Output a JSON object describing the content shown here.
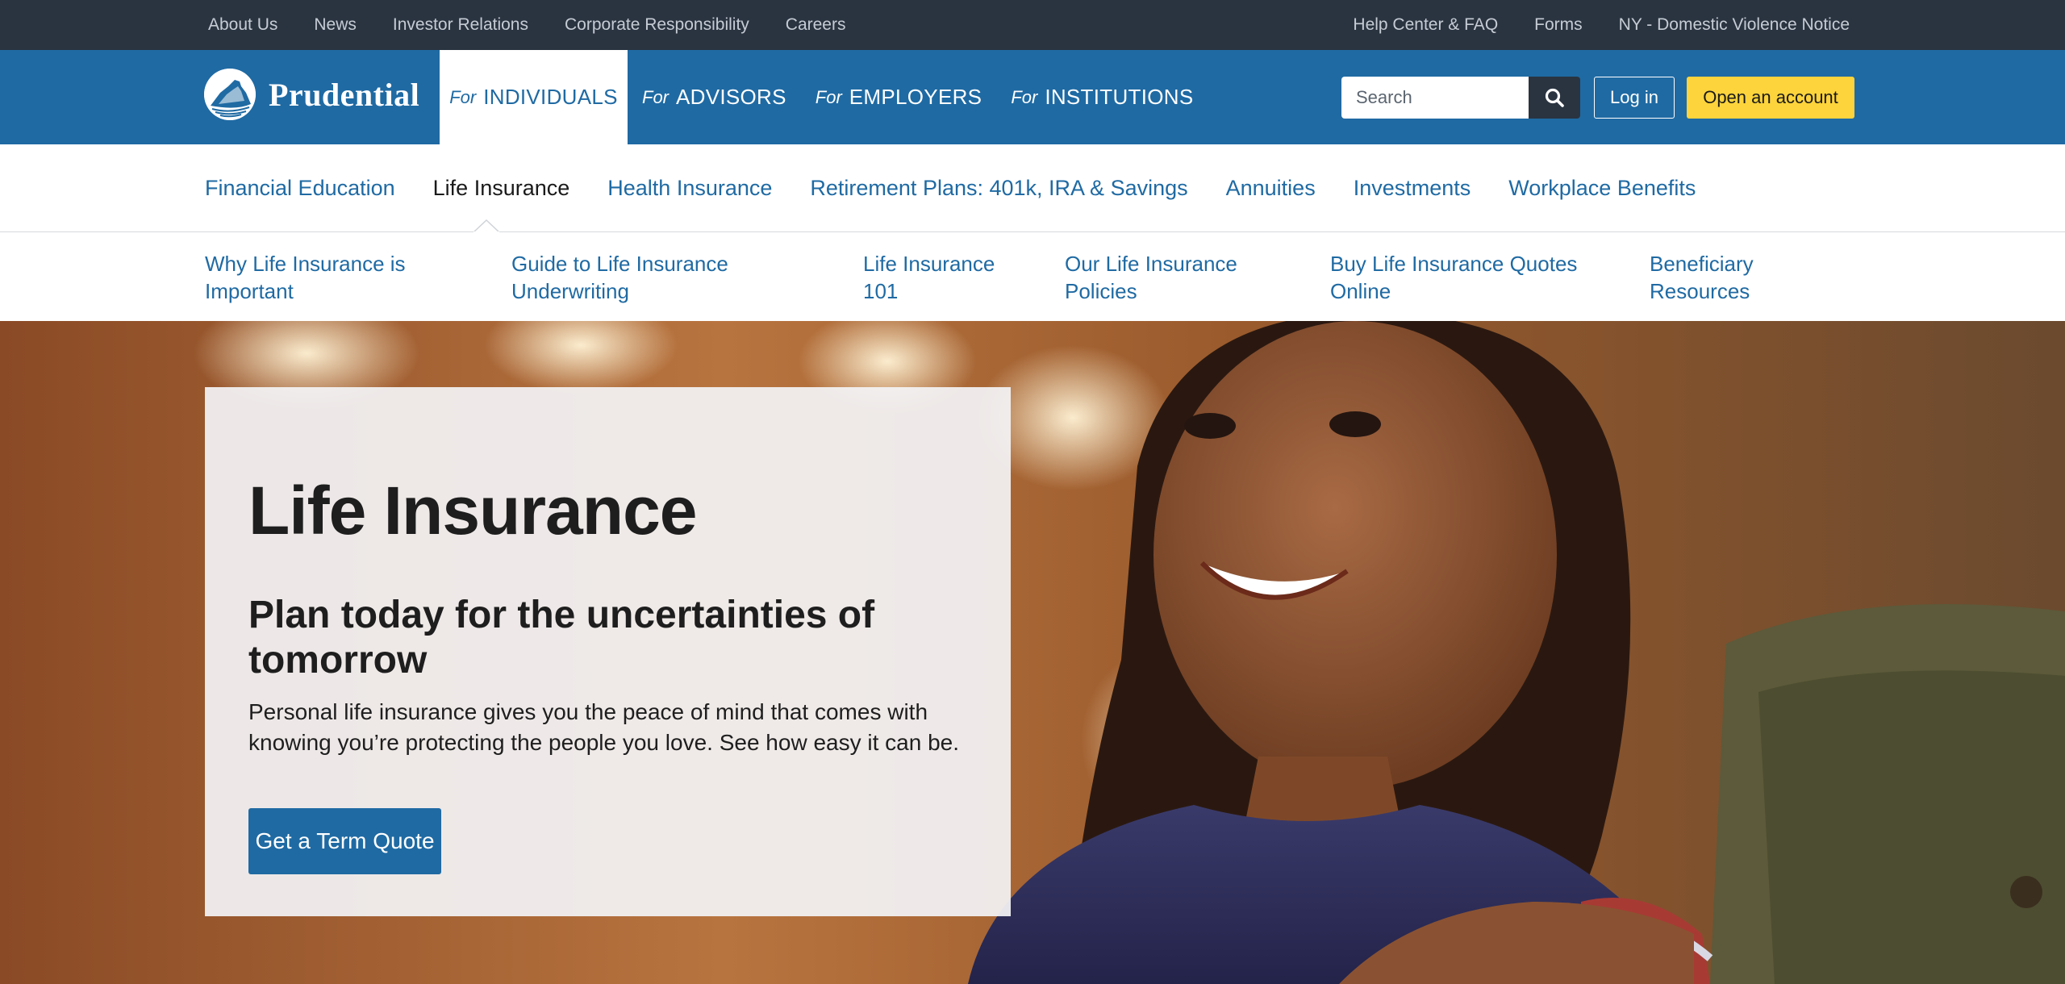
{
  "utility_nav": {
    "left": [
      "About Us",
      "News",
      "Investor Relations",
      "Corporate Responsibility",
      "Careers"
    ],
    "right": [
      "Help Center & FAQ",
      "Forms",
      "NY - Domestic Violence Notice"
    ]
  },
  "header": {
    "logo_text": "Prudential",
    "audience_tabs": [
      {
        "for": "For",
        "label": "INDIVIDUALS",
        "active": true
      },
      {
        "for": "For",
        "label": "ADVISORS",
        "active": false
      },
      {
        "for": "For",
        "label": "EMPLOYERS",
        "active": false
      },
      {
        "for": "For",
        "label": "INSTITUTIONS",
        "active": false
      }
    ],
    "search": {
      "placeholder": "Search",
      "value": ""
    },
    "login_label": "Log in",
    "open_account_label": "Open an account"
  },
  "category_nav": {
    "items": [
      {
        "label": "Financial Education",
        "active": false
      },
      {
        "label": "Life Insurance",
        "active": true
      },
      {
        "label": "Health Insurance",
        "active": false
      },
      {
        "label": "Retirement Plans: 401k, IRA & Savings",
        "active": false
      },
      {
        "label": "Annuities",
        "active": false
      },
      {
        "label": "Investments",
        "active": false
      },
      {
        "label": "Workplace Benefits",
        "active": false
      }
    ]
  },
  "sub_nav": {
    "items": [
      {
        "line1": "Why Life Insurance is",
        "line2": "Important"
      },
      {
        "line1": "Guide to Life Insurance",
        "line2": "Underwriting"
      },
      {
        "line1": "Life Insurance",
        "line2": "101"
      },
      {
        "line1": "Our Life Insurance",
        "line2": "Policies"
      },
      {
        "line1": "Buy Life Insurance Quotes",
        "line2": "Online"
      },
      {
        "line1": "Beneficiary",
        "line2": "Resources"
      }
    ]
  },
  "hero": {
    "title": "Life Insurance",
    "subtitle": "Plan today for the uncertainties of tomorrow",
    "body": "Personal life insurance gives you the peace of mind that comes with knowing you’re protecting the people you love. See how easy it can be.",
    "cta_label": "Get a Term Quote"
  },
  "colors": {
    "brand_blue": "#1f6aa3",
    "utility_bar": "#2a3441",
    "cta_yellow": "#fdd43c"
  },
  "icons": [
    "prudential-rock-logo-icon",
    "search-icon",
    "caret-up-icon"
  ]
}
